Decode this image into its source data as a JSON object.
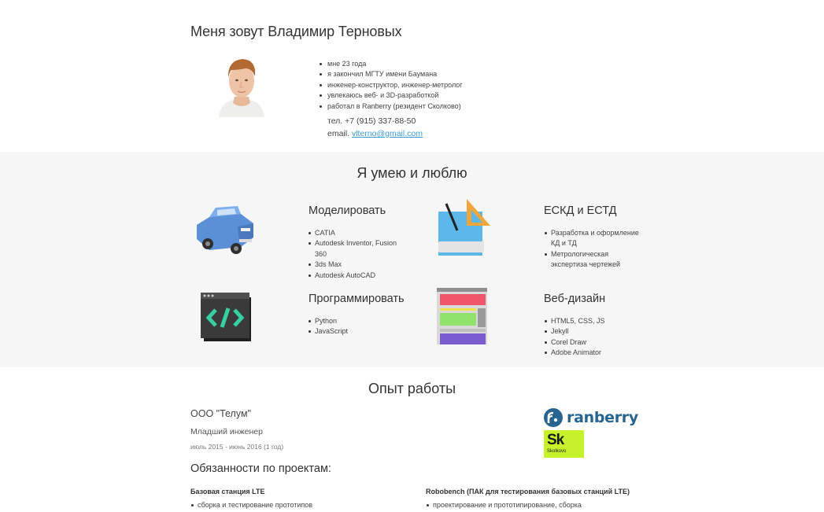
{
  "about": {
    "name": "Меня зовут Владимир Терновых",
    "facts": [
      "мне 23 года",
      "я закончил МГТУ имени Баумана",
      "инженер-конструктор, инженер-метролог",
      "увлекаюсь веб- и 3D-разработкой",
      "работал в Ranberry (резидент Сколково)"
    ],
    "phone": "тел. +7 (915) 337-88-50",
    "email_label": "email.",
    "email": "vlterno@gmail.com"
  },
  "skills": {
    "title": "Я умею и люблю",
    "items": [
      {
        "title": "Моделировать",
        "icon": "car-icon",
        "list": [
          "CATIA",
          "Autodesk Inventor, Fusion 360",
          "3ds Max",
          "Autodesk AutoCAD"
        ]
      },
      {
        "title": "ЕСКД и ЕСТД",
        "icon": "drafting-icon",
        "list": [
          "Разработка и оформление КД и ТД",
          "Метрологическая экспертиза чертежей"
        ]
      },
      {
        "title": "Программировать",
        "icon": "code-window-icon",
        "list": [
          "Python",
          "JavaScript"
        ]
      },
      {
        "title": "Веб-дизайн",
        "icon": "web-layout-icon",
        "list": [
          "HTML5, CSS, JS",
          "Jekyll",
          "Corel Draw",
          "Adobe Animator"
        ]
      }
    ]
  },
  "experience": {
    "title": "Опыт работы",
    "company": "ООО \"Телум\"",
    "position": "Младший инженер",
    "period": "июль 2015 - июнь 2016 (1 год)",
    "duties_title": "Обязанности по проектам:",
    "projects": [
      {
        "name": "Базовая станция LTE",
        "items": [
          "сборка и тестирование прототипов"
        ]
      },
      {
        "name": "Robobench (ПАК для тестирования базовых станций LTE)",
        "items": [
          "проектирование и прототипирование, сборка"
        ]
      }
    ],
    "logos": {
      "ranberry": "ranberry",
      "skolkovo_big": "Sk",
      "skolkovo_small": "Skolkovo"
    }
  },
  "colors": {
    "link": "#3c9bd6",
    "section_bg": "#f6f6f6",
    "ranberry_blue": "#27648f",
    "skolkovo_green": "#c6f12b"
  }
}
